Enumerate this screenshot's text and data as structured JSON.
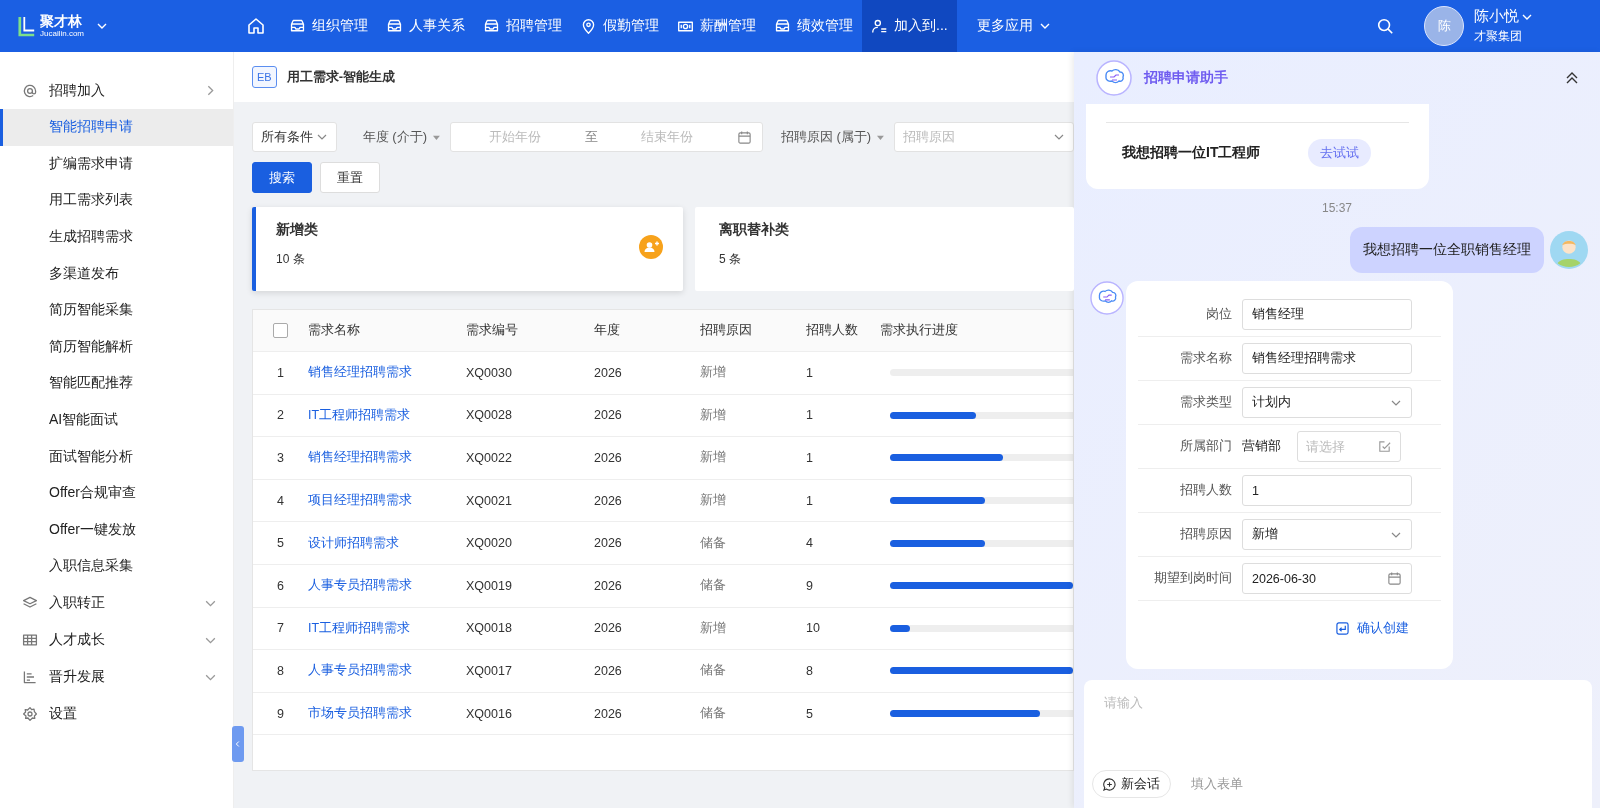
{
  "header": {
    "logo": "聚才林",
    "logo_sub": "Jucailin.com",
    "nav": [
      {
        "label": "组织管理",
        "selected": false
      },
      {
        "label": "人事关系",
        "selected": false
      },
      {
        "label": "招聘管理",
        "selected": false
      },
      {
        "label": "假勤管理",
        "selected": false
      },
      {
        "label": "薪酬管理",
        "selected": false
      },
      {
        "label": "绩效管理",
        "selected": false
      },
      {
        "label": "加入到...",
        "selected": true
      }
    ],
    "more_menu": "更多应用",
    "user": {
      "avatar": "陈",
      "name": "陈小悦",
      "company": "才聚集团"
    }
  },
  "sidebar": {
    "items": [
      {
        "label": "招聘加入",
        "kind": "group",
        "expanded": true,
        "children": [
          {
            "label": "智能招聘申请",
            "selected": true
          },
          {
            "label": "扩编需求申请",
            "selected": false
          },
          {
            "label": "用工需求列表",
            "selected": false
          },
          {
            "label": "生成招聘需求",
            "selected": false
          },
          {
            "label": "多渠道发布",
            "selected": false
          },
          {
            "label": "简历智能采集",
            "selected": false
          },
          {
            "label": "简历智能解析",
            "selected": false
          },
          {
            "label": "智能匹配推荐",
            "selected": false
          },
          {
            "label": "AI智能面试",
            "selected": false
          },
          {
            "label": "面试智能分析",
            "selected": false
          },
          {
            "label": "Offer合规审查",
            "selected": false
          },
          {
            "label": "Offer一键发放",
            "selected": false
          },
          {
            "label": "入职信息采集",
            "selected": false
          }
        ]
      },
      {
        "label": "入职转正",
        "kind": "group",
        "expanded": false
      },
      {
        "label": "人才成长",
        "kind": "group",
        "expanded": false
      },
      {
        "label": "晋升发展",
        "kind": "group",
        "expanded": false
      },
      {
        "label": "设置",
        "kind": "link"
      }
    ]
  },
  "breadcrumb": {
    "badge": "EB",
    "title": "用工需求-智能生成"
  },
  "filters": {
    "condition": "所有条件",
    "year_label": "年度 (介于)",
    "year_start_placeholder": "开始年份",
    "range_separator": "至",
    "year_end_placeholder": "结束年份",
    "reason_label": "招聘原因 (属于)",
    "reason_placeholder": "招聘原因",
    "search_button": "搜索",
    "reset_button": "重置"
  },
  "summary_cards": [
    {
      "title": "新增类",
      "count": "10 条",
      "selected": true
    },
    {
      "title": "离职替补类",
      "count": "5 条",
      "selected": false
    }
  ],
  "table": {
    "select_all": {
      "checked": false
    },
    "columns": [
      "需求名称",
      "需求编号",
      "年度",
      "招聘原因",
      "招聘人数",
      "需求执行进度"
    ],
    "rows": [
      {
        "index": "1",
        "name": "销售经理招聘需求",
        "code": "XQ0030",
        "year": "2026",
        "reason": "新增",
        "count": "1",
        "level": 0
      },
      {
        "index": "2",
        "name": "IT工程师招聘需求",
        "code": "XQ0028",
        "year": "2026",
        "reason": "新增",
        "count": "1",
        "level": 0.47
      },
      {
        "index": "3",
        "name": "销售经理招聘需求",
        "code": "XQ0022",
        "year": "2026",
        "reason": "新增",
        "count": "1",
        "level": 0.62
      },
      {
        "index": "4",
        "name": "项目经理招聘需求",
        "code": "XQ0021",
        "year": "2026",
        "reason": "新增",
        "count": "1",
        "level": 0.52
      },
      {
        "index": "5",
        "name": "设计师招聘需求",
        "code": "XQ0020",
        "year": "2026",
        "reason": "储备",
        "count": "4",
        "level": 0.52
      },
      {
        "index": "6",
        "name": "人事专员招聘需求",
        "code": "XQ0019",
        "year": "2026",
        "reason": "储备",
        "count": "9",
        "level": 1
      },
      {
        "index": "7",
        "name": "IT工程师招聘需求",
        "code": "XQ0018",
        "year": "2026",
        "reason": "新增",
        "count": "10",
        "level": 0.11
      },
      {
        "index": "8",
        "name": "人事专员招聘需求",
        "code": "XQ0017",
        "year": "2026",
        "reason": "储备",
        "count": "8",
        "level": 1
      },
      {
        "index": "9",
        "name": "市场专员招聘需求",
        "code": "XQ0016",
        "year": "2026",
        "reason": "储备",
        "count": "5",
        "level": 0.82
      }
    ]
  },
  "assistant": {
    "title": "招聘申请助手",
    "suggestion": "我想招聘一位IT工程师",
    "try_button": "去试试",
    "time": "15:37",
    "user_message": "我想招聘一位全职销售经理",
    "form": [
      {
        "label": "岗位",
        "kind": "input",
        "value": "销售经理"
      },
      {
        "label": "需求名称",
        "kind": "input",
        "value": "销售经理招聘需求"
      },
      {
        "label": "需求类型",
        "kind": "select",
        "value": "计划内"
      },
      {
        "label": "所属部门",
        "kind": "picker",
        "value": "营销部",
        "placeholder": "请选择"
      },
      {
        "label": "招聘人数",
        "kind": "input",
        "value": "1"
      },
      {
        "label": "招聘原因",
        "kind": "select",
        "value": "新增"
      },
      {
        "label": "期望到岗时间",
        "kind": "date",
        "value": "2026-06-30"
      }
    ],
    "confirm": "确认创建",
    "input_placeholder": "请输入",
    "new_chat": "新会话",
    "fill_form": "填入表单"
  }
}
